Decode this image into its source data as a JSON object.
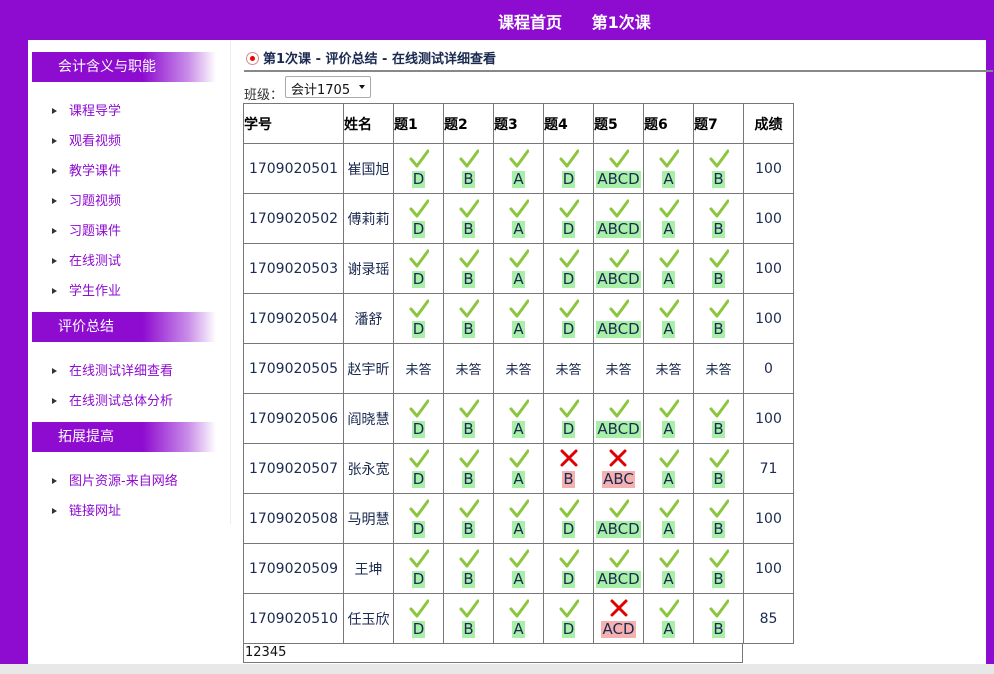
{
  "header": {
    "nav": [
      "课程首页",
      "第1次课"
    ]
  },
  "sidebar": {
    "sections": [
      {
        "title": "会计含义与职能",
        "items": [
          "课程导学",
          "观看视频",
          "教学课件",
          "习题视频",
          "习题课件",
          "在线测试",
          "学生作业"
        ]
      },
      {
        "title": "评价总结",
        "items": [
          "在线测试详细查看",
          "在线测试总体分析"
        ]
      },
      {
        "title": "拓展提高",
        "items": [
          "图片资源-来自网络",
          "链接网址"
        ]
      }
    ]
  },
  "breadcrumb": "第1次课 - 评价总结 - 在线测试详细查看",
  "class_filter": {
    "label": "班级：",
    "selected": "会计1705"
  },
  "table": {
    "headers": [
      "学号",
      "姓名",
      "题1",
      "题2",
      "题3",
      "题4",
      "题5",
      "题6",
      "题7",
      "成绩"
    ],
    "rows": [
      {
        "id": "1709020501",
        "name": "崔国旭",
        "answers": [
          [
            "D",
            "ok"
          ],
          [
            "B",
            "ok"
          ],
          [
            "A",
            "ok"
          ],
          [
            "D",
            "ok"
          ],
          [
            "ABCD",
            "ok"
          ],
          [
            "A",
            "ok"
          ],
          [
            "B",
            "ok"
          ]
        ],
        "score": "100"
      },
      {
        "id": "1709020502",
        "name": "傅莉莉",
        "answers": [
          [
            "D",
            "ok"
          ],
          [
            "B",
            "ok"
          ],
          [
            "A",
            "ok"
          ],
          [
            "D",
            "ok"
          ],
          [
            "ABCD",
            "ok"
          ],
          [
            "A",
            "ok"
          ],
          [
            "B",
            "ok"
          ]
        ],
        "score": "100"
      },
      {
        "id": "1709020503",
        "name": "谢录瑶",
        "answers": [
          [
            "D",
            "ok"
          ],
          [
            "B",
            "ok"
          ],
          [
            "A",
            "ok"
          ],
          [
            "D",
            "ok"
          ],
          [
            "ABCD",
            "ok"
          ],
          [
            "A",
            "ok"
          ],
          [
            "B",
            "ok"
          ]
        ],
        "score": "100"
      },
      {
        "id": "1709020504",
        "name": "潘舒",
        "answers": [
          [
            "D",
            "ok"
          ],
          [
            "B",
            "ok"
          ],
          [
            "A",
            "ok"
          ],
          [
            "D",
            "ok"
          ],
          [
            "ABCD",
            "ok"
          ],
          [
            "A",
            "ok"
          ],
          [
            "B",
            "ok"
          ]
        ],
        "score": "100"
      },
      {
        "id": "1709020505",
        "name": "赵宇昕",
        "answers": [
          [
            "未答",
            "none"
          ],
          [
            "未答",
            "none"
          ],
          [
            "未答",
            "none"
          ],
          [
            "未答",
            "none"
          ],
          [
            "未答",
            "none"
          ],
          [
            "未答",
            "none"
          ],
          [
            "未答",
            "none"
          ]
        ],
        "score": "0"
      },
      {
        "id": "1709020506",
        "name": "阎晓慧",
        "answers": [
          [
            "D",
            "ok"
          ],
          [
            "B",
            "ok"
          ],
          [
            "A",
            "ok"
          ],
          [
            "D",
            "ok"
          ],
          [
            "ABCD",
            "ok"
          ],
          [
            "A",
            "ok"
          ],
          [
            "B",
            "ok"
          ]
        ],
        "score": "100"
      },
      {
        "id": "1709020507",
        "name": "张永宽",
        "answers": [
          [
            "D",
            "ok"
          ],
          [
            "B",
            "ok"
          ],
          [
            "A",
            "ok"
          ],
          [
            "B",
            "bad"
          ],
          [
            "ABC",
            "bad"
          ],
          [
            "A",
            "ok"
          ],
          [
            "B",
            "ok"
          ]
        ],
        "score": "71"
      },
      {
        "id": "1709020508",
        "name": "马明慧",
        "answers": [
          [
            "D",
            "ok"
          ],
          [
            "B",
            "ok"
          ],
          [
            "A",
            "ok"
          ],
          [
            "D",
            "ok"
          ],
          [
            "ABCD",
            "ok"
          ],
          [
            "A",
            "ok"
          ],
          [
            "B",
            "ok"
          ]
        ],
        "score": "100"
      },
      {
        "id": "1709020509",
        "name": "王坤",
        "answers": [
          [
            "D",
            "ok"
          ],
          [
            "B",
            "ok"
          ],
          [
            "A",
            "ok"
          ],
          [
            "D",
            "ok"
          ],
          [
            "ABCD",
            "ok"
          ],
          [
            "A",
            "ok"
          ],
          [
            "B",
            "ok"
          ]
        ],
        "score": "100"
      },
      {
        "id": "1709020510",
        "name": "任玉欣",
        "answers": [
          [
            "D",
            "ok"
          ],
          [
            "B",
            "ok"
          ],
          [
            "A",
            "ok"
          ],
          [
            "D",
            "ok"
          ],
          [
            "ACD",
            "bad"
          ],
          [
            "A",
            "ok"
          ],
          [
            "B",
            "ok"
          ]
        ],
        "score": "85"
      }
    ]
  },
  "pager": "12345",
  "colors": {
    "brand": "#8e0bd0",
    "correct_bg": "#a8f0a8",
    "wrong_bg": "#f5b0b0",
    "check": "#8cc63f",
    "cross": "#e00000"
  }
}
